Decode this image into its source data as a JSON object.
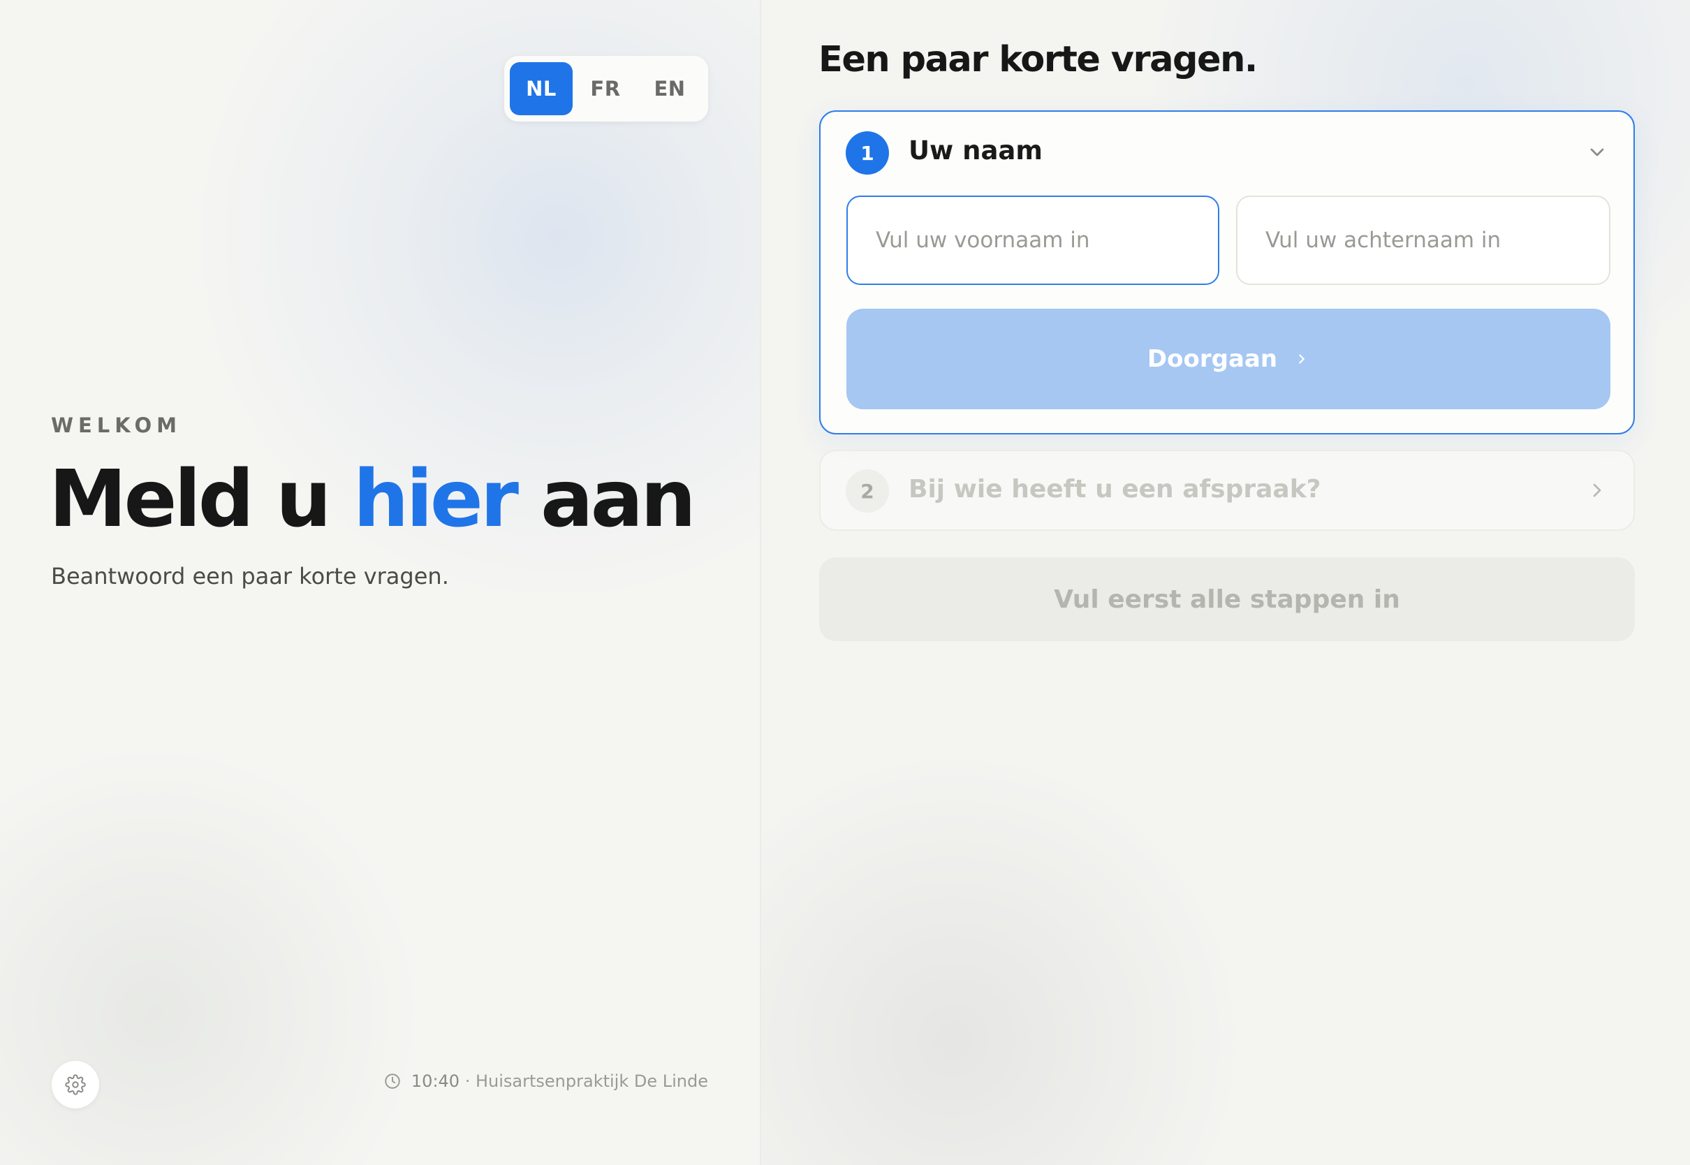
{
  "colors": {
    "accent": "#1f74e8",
    "background": "#f4f4f1",
    "disabled_button": "#a5c7f2"
  },
  "languages": {
    "items": [
      "NL",
      "FR",
      "EN"
    ],
    "selected": "NL"
  },
  "welcome": {
    "eyebrow": "WELKOM",
    "headline_part1": "Meld u ",
    "headline_highlight": "hier",
    "headline_part2": " aan",
    "subtitle": "Beantwoord een paar korte vragen."
  },
  "footer": {
    "settings_icon": "gear-icon",
    "clock_icon": "clock-icon",
    "time": "10:40",
    "separator": "·",
    "practice": "Huisartsenpraktijk De Linde"
  },
  "form": {
    "title": "Een paar korte vragen.",
    "steps": [
      {
        "number": "1",
        "title": "Uw naam",
        "expanded": true,
        "icon": "chevron-down-icon",
        "fields": {
          "first_name_placeholder": "Vul uw voornaam in",
          "first_name_value": "",
          "last_name_placeholder": "Vul uw achternaam in",
          "last_name_value": ""
        },
        "continue_label": "Doorgaan",
        "continue_icon": "chevron-right-icon"
      },
      {
        "number": "2",
        "title": "Bij wie heeft u een afspraak?",
        "expanded": false,
        "icon": "chevron-right-icon"
      }
    ],
    "submit_label": "Vul eerst alle stappen in"
  }
}
